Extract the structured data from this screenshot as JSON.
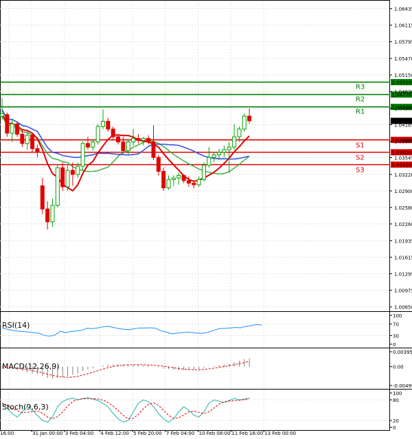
{
  "chart_data": {
    "type": "candlestick",
    "price_axis": {
      "ylim": [
        1.0648,
        1.0655
      ],
      "ticks": [
        "1.06435",
        "1.06115",
        "1.05795",
        "1.05470",
        "1.05150",
        "1.04830",
        "1.04505",
        "1.04185",
        "1.03865",
        "1.03545",
        "1.03220",
        "1.02900",
        "1.02580",
        "1.02260",
        "1.01935",
        "1.01615",
        "1.01295",
        "1.00975",
        "1.00650"
      ],
      "tick_values": [
        1.06435,
        1.06115,
        1.05795,
        1.0547,
        1.0515,
        1.0483,
        1.04505,
        1.04185,
        1.03865,
        1.03545,
        1.0322,
        1.029,
        1.0258,
        1.0226,
        1.01935,
        1.01615,
        1.01295,
        1.00975,
        1.0065
      ],
      "current_price": "1.04259",
      "min": 1.0058,
      "max": 1.0655
    },
    "x_axis": {
      "ticks": [
        "16:00",
        "31 Jan 00:00",
        "3 Feb 04:00",
        "4 Feb 12:00",
        "5 Feb 20:00",
        "7 Feb 04:00",
        "10 Feb 08:00",
        "11 Feb 16:00",
        "13 Feb 00:00"
      ],
      "tick_index": [
        0,
        4.5,
        11,
        18,
        24.5,
        31,
        37.5,
        44,
        50.5
      ]
    },
    "levels": [
      {
        "name": "R3",
        "value": 1.0501,
        "label": "1.05010",
        "color": "#008000"
      },
      {
        "name": "R2",
        "value": 1.0477,
        "label": "1.04770",
        "color": "#008000"
      },
      {
        "name": "R1",
        "value": 1.0453,
        "label": "1.04530",
        "color": "#008000"
      },
      {
        "name": "S1",
        "value": 1.0389,
        "label": "1.03890",
        "color": "#e00000"
      },
      {
        "name": "S2",
        "value": 1.0365,
        "label": "1.03650",
        "color": "#e00000"
      },
      {
        "name": "S3",
        "value": 1.0341,
        "label": "1.03410",
        "color": "#e00000"
      }
    ],
    "candles": [
      [
        1.0435,
        1.047,
        1.0428,
        1.044
      ],
      [
        1.0438,
        1.0442,
        1.0395,
        1.0402
      ],
      [
        1.0402,
        1.043,
        1.0385,
        1.042
      ],
      [
        1.042,
        1.0425,
        1.0395,
        1.04
      ],
      [
        1.04,
        1.041,
        1.0375,
        1.0382
      ],
      [
        1.0382,
        1.0405,
        1.037,
        1.0398
      ],
      [
        1.0398,
        1.04,
        1.0365,
        1.0372
      ],
      [
        1.0372,
        1.038,
        1.0355,
        1.0365
      ],
      [
        1.03,
        1.0315,
        1.0245,
        1.0255
      ],
      [
        1.0255,
        1.027,
        1.0215,
        1.023
      ],
      [
        1.023,
        1.0275,
        1.022,
        1.0262
      ],
      [
        1.0262,
        1.034,
        1.0258,
        1.0335
      ],
      [
        1.0335,
        1.0345,
        1.029,
        1.0298
      ],
      [
        1.0298,
        1.034,
        1.029,
        1.033
      ],
      [
        1.033,
        1.0345,
        1.03,
        1.0322
      ],
      [
        1.0322,
        1.0345,
        1.0315,
        1.0338
      ],
      [
        1.0338,
        1.0385,
        1.033,
        1.0382
      ],
      [
        1.0382,
        1.0395,
        1.037,
        1.0375
      ],
      [
        1.0375,
        1.039,
        1.0368,
        1.0385
      ],
      [
        1.0385,
        1.042,
        1.038,
        1.0415
      ],
      [
        1.0415,
        1.0448,
        1.041,
        1.0425
      ],
      [
        1.0425,
        1.0432,
        1.0405,
        1.041
      ],
      [
        1.041,
        1.0415,
        1.039,
        1.0395
      ],
      [
        1.0395,
        1.04,
        1.038,
        1.0385
      ],
      [
        1.0385,
        1.0395,
        1.0362,
        1.0368
      ],
      [
        1.0368,
        1.039,
        1.036,
        1.0385
      ],
      [
        1.0385,
        1.041,
        1.0378,
        1.0392
      ],
      [
        1.0392,
        1.04,
        1.0382,
        1.0388
      ],
      [
        1.0388,
        1.0395,
        1.0378,
        1.0392
      ],
      [
        1.0392,
        1.0398,
        1.038,
        1.0385
      ],
      [
        1.0385,
        1.0418,
        1.035,
        1.0355
      ],
      [
        1.0355,
        1.036,
        1.032,
        1.0328
      ],
      [
        1.0328,
        1.0335,
        1.029,
        1.0296
      ],
      [
        1.0296,
        1.032,
        1.0292,
        1.0312
      ],
      [
        1.0312,
        1.032,
        1.03,
        1.0315
      ],
      [
        1.0315,
        1.0325,
        1.0302,
        1.032
      ],
      [
        1.032,
        1.0322,
        1.0305,
        1.031
      ],
      [
        1.031,
        1.0318,
        1.0298,
        1.0305
      ],
      [
        1.0305,
        1.031,
        1.0295,
        1.0302
      ],
      [
        1.0302,
        1.0318,
        1.0298,
        1.0312
      ],
      [
        1.0312,
        1.0345,
        1.0308,
        1.034
      ],
      [
        1.034,
        1.0375,
        1.0335,
        1.0355
      ],
      [
        1.0355,
        1.0365,
        1.0345,
        1.036
      ],
      [
        1.036,
        1.0372,
        1.035,
        1.0365
      ],
      [
        1.0365,
        1.0378,
        1.0355,
        1.037
      ],
      [
        1.037,
        1.0385,
        1.0325,
        1.0375
      ],
      [
        1.0375,
        1.042,
        1.037,
        1.0395
      ],
      [
        1.0395,
        1.0415,
        1.0385,
        1.041
      ],
      [
        1.041,
        1.044,
        1.0405,
        1.0435
      ],
      [
        1.0435,
        1.045,
        1.042,
        1.0426
      ]
    ],
    "indicators": {
      "rsi": {
        "label": "RSI(14)",
        "ticks": [
          "100",
          "70",
          "30",
          "0"
        ],
        "tick_values": [
          100,
          70,
          30,
          0
        ]
      },
      "macd": {
        "label": "MACD(12,26,9)",
        "ticks": [
          "0.003955",
          "0.00",
          "-0.004995"
        ],
        "tick_values": [
          0.003955,
          0,
          -0.004995
        ]
      },
      "stoch": {
        "label": "Stoch(9,6,3)",
        "ticks": [
          "100",
          "80",
          "20",
          "0"
        ],
        "tick_values": [
          100,
          80,
          20,
          0
        ]
      }
    },
    "colors": {
      "bull": "#00a000",
      "bear": "#e00000",
      "bull_body": "#ffffff",
      "bear_body": "#e00000",
      "ma_blue": "#3355dd",
      "ma_red": "#e00000",
      "ma_green": "#33aa33",
      "rsi": "#1e90ff",
      "macd_hist": "#808080",
      "macd_signal": "#e00000",
      "stoch_main": "#20b2aa",
      "stoch_signal": "#e00000",
      "grid": "#c8c8c8",
      "current_bg": "#000000",
      "level_label_green": "#008000",
      "level_label_red": "#e00000"
    }
  }
}
